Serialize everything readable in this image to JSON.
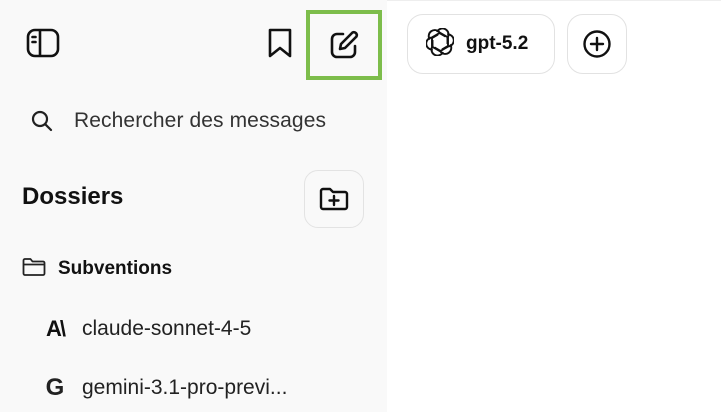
{
  "sidebar": {
    "toggle_icon": "sidebar-toggle-icon",
    "bookmark_icon": "bookmark-icon",
    "new_chat_icon": "edit-icon",
    "new_chat_highlight_color": "#7dbd4b",
    "search": {
      "placeholder": "Rechercher des messages",
      "icon": "search-icon"
    },
    "folders": {
      "title": "Dossiers",
      "add_icon": "folder-plus-icon",
      "items": [
        {
          "label": "Subventions",
          "icon": "folder-icon",
          "chats": [
            {
              "label": "claude-sonnet-4-5",
              "icon": "anthropic-icon",
              "glyph": "A\\"
            },
            {
              "label": "gemini-3.1-pro-previ...",
              "icon": "google-icon",
              "glyph": "G"
            }
          ]
        }
      ]
    }
  },
  "header": {
    "model_selector": {
      "label": "gpt-5.2",
      "icon": "openai-icon"
    },
    "add_model_icon": "plus-circle-icon"
  },
  "colors": {
    "sidebar_bg": "#f9f9f9",
    "main_bg": "#ffffff",
    "highlight": "#7dbd4b"
  }
}
